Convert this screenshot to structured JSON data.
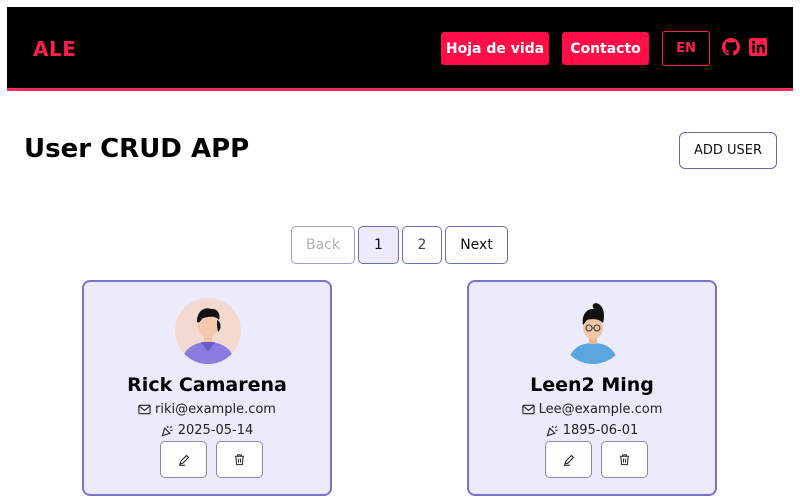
{
  "header": {
    "brand": "ALE",
    "nav_cv": "Hoja de vida",
    "nav_contact": "Contacto",
    "lang": "EN",
    "icons": [
      "github-icon",
      "linkedin-icon"
    ],
    "accent": "#ff0f47"
  },
  "main": {
    "title": "User CRUD APP",
    "add_label": "ADD USER"
  },
  "pagination": {
    "back": "Back",
    "pages": [
      "1",
      "2"
    ],
    "active_page": "1",
    "next": "Next"
  },
  "users": [
    {
      "name": "Rick Camarena",
      "email": "riki@example.com",
      "birthday": "2025-05-14"
    },
    {
      "name": "Leen2 Ming",
      "email": "Lee@example.com",
      "birthday": "1895-06-01"
    }
  ],
  "card_colors": {
    "background": "#ebebfb",
    "border": "#7a72d0"
  }
}
